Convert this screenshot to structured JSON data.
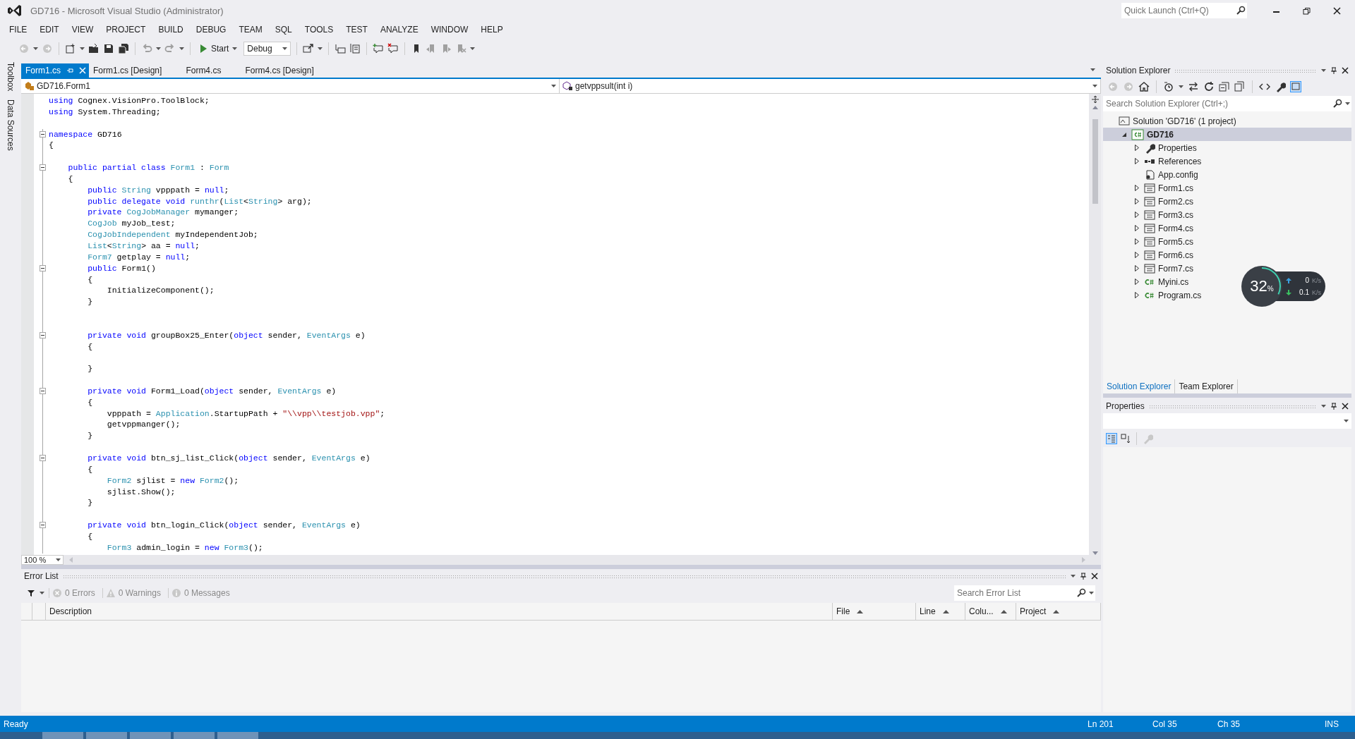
{
  "window": {
    "title": "GD716 - Microsoft Visual Studio (Administrator)",
    "quick_launch": {
      "placeholder": "Quick Launch (Ctrl+Q)"
    }
  },
  "menu": [
    "FILE",
    "EDIT",
    "VIEW",
    "PROJECT",
    "BUILD",
    "DEBUG",
    "TEAM",
    "SQL",
    "TOOLS",
    "TEST",
    "ANALYZE",
    "WINDOW",
    "HELP"
  ],
  "toolbar": {
    "start": "Start",
    "configuration": "Debug"
  },
  "side_strip": [
    "Toolbox",
    "Data Sources"
  ],
  "document_tabs": [
    {
      "label": "Form1.cs",
      "selected": true
    },
    {
      "label": "Form1.cs [Design]",
      "selected": false
    },
    {
      "label": "Form4.cs",
      "selected": false
    },
    {
      "label": "Form4.cs [Design]",
      "selected": false
    }
  ],
  "navigation": {
    "type": "GD716.Form1",
    "member": "getvppsult(int i)"
  },
  "editor": {
    "zoom": "100 %",
    "lines": [
      {
        "fold": false,
        "tokens": [
          {
            "kind": "kw",
            "text": "using"
          },
          {
            "kind": "plain",
            "text": " Cognex.VisionPro.ToolBlock;"
          }
        ]
      },
      {
        "fold": false,
        "tokens": [
          {
            "kind": "kw",
            "text": "using"
          },
          {
            "kind": "plain",
            "text": " System.Threading;"
          }
        ]
      },
      {
        "fold": false
      },
      {
        "fold": true,
        "tokens": [
          {
            "kind": "kw",
            "text": "namespace"
          },
          {
            "kind": "plain",
            "text": " GD716"
          }
        ]
      },
      {
        "fold": false,
        "tokens": [
          {
            "kind": "plain",
            "text": "{"
          }
        ]
      },
      {
        "fold": false
      },
      {
        "fold": true,
        "tokens": [
          {
            "kind": "kw",
            "text": "    public partial class "
          },
          {
            "kind": "type",
            "text": "Form1"
          },
          {
            "kind": "plain",
            "text": " : "
          },
          {
            "kind": "type",
            "text": "Form"
          }
        ]
      },
      {
        "fold": false,
        "tokens": [
          {
            "kind": "plain",
            "text": "    {"
          }
        ]
      },
      {
        "fold": false,
        "tokens": [
          {
            "kind": "kw",
            "text": "        public "
          },
          {
            "kind": "type",
            "text": "String"
          },
          {
            "kind": "plain",
            "text": " vpppath = "
          },
          {
            "kind": "kw",
            "text": "null"
          },
          {
            "kind": "plain",
            "text": ";"
          }
        ]
      },
      {
        "fold": false,
        "tokens": [
          {
            "kind": "kw",
            "text": "        public delegate void "
          },
          {
            "kind": "type",
            "text": "runthr"
          },
          {
            "kind": "plain",
            "text": "("
          },
          {
            "kind": "type",
            "text": "List"
          },
          {
            "kind": "plain",
            "text": "<"
          },
          {
            "kind": "type",
            "text": "String"
          },
          {
            "kind": "plain",
            "text": "> arg);"
          }
        ]
      },
      {
        "fold": false,
        "tokens": [
          {
            "kind": "kw",
            "text": "        private "
          },
          {
            "kind": "type",
            "text": "CogJobManager"
          },
          {
            "kind": "plain",
            "text": " mymanger;"
          }
        ]
      },
      {
        "fold": false,
        "tokens": [
          {
            "kind": "type",
            "text": "        CogJob"
          },
          {
            "kind": "plain",
            "text": " myJob_test;"
          }
        ]
      },
      {
        "fold": false,
        "tokens": [
          {
            "kind": "type",
            "text": "        CogJobIndependent"
          },
          {
            "kind": "plain",
            "text": " myIndependentJob;"
          }
        ]
      },
      {
        "fold": false,
        "tokens": [
          {
            "kind": "type",
            "text": "        List"
          },
          {
            "kind": "plain",
            "text": "<"
          },
          {
            "kind": "type",
            "text": "String"
          },
          {
            "kind": "plain",
            "text": "> aa = "
          },
          {
            "kind": "kw",
            "text": "null"
          },
          {
            "kind": "plain",
            "text": ";"
          }
        ]
      },
      {
        "fold": false,
        "tokens": [
          {
            "kind": "type",
            "text": "        Form7"
          },
          {
            "kind": "plain",
            "text": " getplay = "
          },
          {
            "kind": "kw",
            "text": "null"
          },
          {
            "kind": "plain",
            "text": ";"
          }
        ]
      },
      {
        "fold": true,
        "tokens": [
          {
            "kind": "kw",
            "text": "        public"
          },
          {
            "kind": "plain",
            "text": " Form1()"
          }
        ]
      },
      {
        "fold": false,
        "tokens": [
          {
            "kind": "plain",
            "text": "        {"
          }
        ]
      },
      {
        "fold": false,
        "tokens": [
          {
            "kind": "plain",
            "text": "            InitializeComponent();"
          }
        ]
      },
      {
        "fold": false,
        "tokens": [
          {
            "kind": "plain",
            "text": "        }"
          }
        ]
      },
      {
        "fold": false
      },
      {
        "fold": false
      },
      {
        "fold": true,
        "tokens": [
          {
            "kind": "kw",
            "text": "        private void"
          },
          {
            "kind": "plain",
            "text": " groupBox25_Enter("
          },
          {
            "kind": "kw",
            "text": "object"
          },
          {
            "kind": "plain",
            "text": " sender, "
          },
          {
            "kind": "type",
            "text": "EventArgs"
          },
          {
            "kind": "plain",
            "text": " e)"
          }
        ]
      },
      {
        "fold": false,
        "tokens": [
          {
            "kind": "plain",
            "text": "        {"
          }
        ]
      },
      {
        "fold": false
      },
      {
        "fold": false,
        "tokens": [
          {
            "kind": "plain",
            "text": "        }"
          }
        ]
      },
      {
        "fold": false
      },
      {
        "fold": true,
        "tokens": [
          {
            "kind": "kw",
            "text": "        private void"
          },
          {
            "kind": "plain",
            "text": " Form1_Load("
          },
          {
            "kind": "kw",
            "text": "object"
          },
          {
            "kind": "plain",
            "text": " sender, "
          },
          {
            "kind": "type",
            "text": "EventArgs"
          },
          {
            "kind": "plain",
            "text": " e)"
          }
        ]
      },
      {
        "fold": false,
        "tokens": [
          {
            "kind": "plain",
            "text": "        {"
          }
        ]
      },
      {
        "fold": false,
        "tokens": [
          {
            "kind": "plain",
            "text": "            vpppath = "
          },
          {
            "kind": "type",
            "text": "Application"
          },
          {
            "kind": "plain",
            "text": ".StartupPath + "
          },
          {
            "kind": "str",
            "text": "\"\\\\vpp\\\\testjob.vpp\""
          },
          {
            "kind": "plain",
            "text": ";"
          }
        ]
      },
      {
        "fold": false,
        "tokens": [
          {
            "kind": "plain",
            "text": "            getvppmanger();"
          }
        ]
      },
      {
        "fold": false,
        "tokens": [
          {
            "kind": "plain",
            "text": "        }"
          }
        ]
      },
      {
        "fold": false
      },
      {
        "fold": true,
        "tokens": [
          {
            "kind": "kw",
            "text": "        private void"
          },
          {
            "kind": "plain",
            "text": " btn_sj_list_Click("
          },
          {
            "kind": "kw",
            "text": "object"
          },
          {
            "kind": "plain",
            "text": " sender, "
          },
          {
            "kind": "type",
            "text": "EventArgs"
          },
          {
            "kind": "plain",
            "text": " e)"
          }
        ]
      },
      {
        "fold": false,
        "tokens": [
          {
            "kind": "plain",
            "text": "        {"
          }
        ]
      },
      {
        "fold": false,
        "tokens": [
          {
            "kind": "type",
            "text": "            Form2"
          },
          {
            "kind": "plain",
            "text": " sjlist = "
          },
          {
            "kind": "kw",
            "text": "new "
          },
          {
            "kind": "type",
            "text": "Form2"
          },
          {
            "kind": "plain",
            "text": "();"
          }
        ]
      },
      {
        "fold": false,
        "tokens": [
          {
            "kind": "plain",
            "text": "            sjlist.Show();"
          }
        ]
      },
      {
        "fold": false,
        "tokens": [
          {
            "kind": "plain",
            "text": "        }"
          }
        ]
      },
      {
        "fold": false
      },
      {
        "fold": true,
        "tokens": [
          {
            "kind": "kw",
            "text": "        private void"
          },
          {
            "kind": "plain",
            "text": " btn_login_Click("
          },
          {
            "kind": "kw",
            "text": "object"
          },
          {
            "kind": "plain",
            "text": " sender, "
          },
          {
            "kind": "type",
            "text": "EventArgs"
          },
          {
            "kind": "plain",
            "text": " e)"
          }
        ]
      },
      {
        "fold": false,
        "tokens": [
          {
            "kind": "plain",
            "text": "        {"
          }
        ]
      },
      {
        "fold": false,
        "tokens": [
          {
            "kind": "type",
            "text": "            Form3"
          },
          {
            "kind": "plain",
            "text": " admin_login = "
          },
          {
            "kind": "kw",
            "text": "new "
          },
          {
            "kind": "type",
            "text": "Form3"
          },
          {
            "kind": "plain",
            "text": "();"
          }
        ]
      }
    ]
  },
  "solution_explorer": {
    "title": "Solution Explorer",
    "search": {
      "placeholder": "Search Solution Explorer (Ctrl+;)"
    },
    "tree": [
      {
        "label": "Solution 'GD716' (1 project)",
        "kind": "solution",
        "selected": false,
        "children": [
          {
            "label": "GD716",
            "kind": "project",
            "expanded": true,
            "selected": true,
            "children": [
              {
                "label": "Properties",
                "kind": "properties",
                "expanded": false,
                "selected": false
              },
              {
                "label": "References",
                "kind": "references",
                "expanded": false,
                "selected": false
              },
              {
                "label": "App.config",
                "kind": "config",
                "selected": false
              },
              {
                "label": "Form1.cs",
                "kind": "form",
                "expanded": false,
                "selected": false
              },
              {
                "label": "Form2.cs",
                "kind": "form",
                "expanded": false,
                "selected": false
              },
              {
                "label": "Form3.cs",
                "kind": "form",
                "expanded": false,
                "selected": false
              },
              {
                "label": "Form4.cs",
                "kind": "form",
                "expanded": false,
                "selected": false
              },
              {
                "label": "Form5.cs",
                "kind": "form",
                "expanded": false,
                "selected": false
              },
              {
                "label": "Form6.cs",
                "kind": "form",
                "expanded": false,
                "selected": false
              },
              {
                "label": "Form7.cs",
                "kind": "form",
                "expanded": false,
                "selected": false
              },
              {
                "label": "Myini.cs",
                "kind": "csharp",
                "expanded": false,
                "selected": false
              },
              {
                "label": "Program.cs",
                "kind": "csharp",
                "expanded": false,
                "selected": false
              }
            ]
          }
        ]
      }
    ]
  },
  "panel_tabs": [
    {
      "label": "Solution Explorer",
      "selected": true
    },
    {
      "label": "Team Explorer",
      "selected": false
    }
  ],
  "properties": {
    "title": "Properties"
  },
  "error_list": {
    "title": "Error List",
    "filters": [
      {
        "kind": "error",
        "label": "0 Errors"
      },
      {
        "kind": "warning",
        "label": "0 Warnings"
      },
      {
        "kind": "message",
        "label": "0 Messages"
      }
    ],
    "search": {
      "placeholder": "Search Error List"
    },
    "columns": [
      "Description",
      "File",
      "Line",
      "Colu...",
      "Project"
    ]
  },
  "status_bar": {
    "message": "Ready",
    "items": [
      "Ln 201",
      "Col 35",
      "Ch 35",
      "INS"
    ]
  },
  "network_widget": {
    "cpu": "32",
    "cpu_unit": "%",
    "level": 0.32,
    "upload": "0",
    "upload_unit": "K/s",
    "download": "0.1",
    "download_unit": "K/s"
  }
}
